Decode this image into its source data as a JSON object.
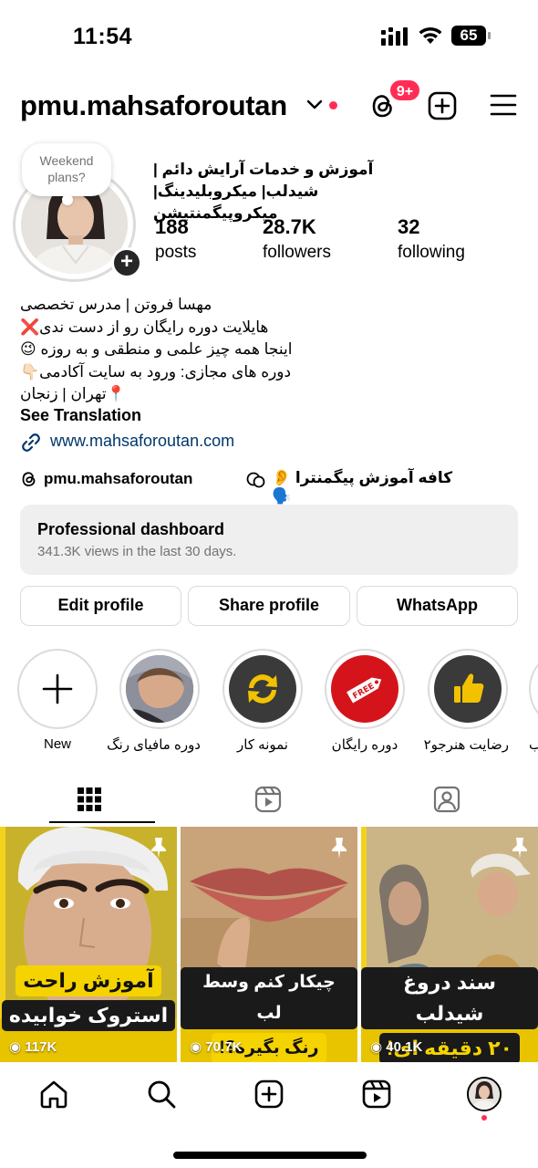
{
  "status": {
    "time": "11:54",
    "battery": "65"
  },
  "header": {
    "username": "pmu.mahsaforoutan",
    "notif_badge": "9+"
  },
  "note": {
    "line1": "Weekend",
    "line2": "plans?"
  },
  "profile": {
    "fullname": "آموزش و خدمات آرایش دائم | شیدلب| میکروبلیدینگ|میکروپیگمنتیشن",
    "stats": [
      {
        "num": "188",
        "label": "posts"
      },
      {
        "num": "28.7K",
        "label": "followers"
      },
      {
        "num": "32",
        "label": "following"
      }
    ],
    "bio": [
      "مهسا فروتن | مدرس تخصصی",
      "هایلایت دوره رایگان رو از دست ندی❌",
      "اینجا همه چیز علمی و منطقی و به روزه 😉",
      "دوره های مجازی: ورود به سایت آکادمی👇🏻",
      "📍تهران | زنجان"
    ],
    "see_translation": "See Translation",
    "link": "www.mahsaforoutan.com",
    "threads_handle": "pmu.mahsaforoutan",
    "channel": "کافه آموزش پیگمنترا 👂🗣️"
  },
  "dashboard": {
    "title": "Professional dashboard",
    "subtitle": "341.3K views in the last 30 days."
  },
  "buttons": {
    "edit": "Edit profile",
    "share": "Share profile",
    "whatsapp": "WhatsApp"
  },
  "highlights": [
    {
      "label": "New",
      "icon": "plus-icon"
    },
    {
      "label": "دوره مافیای رنگ",
      "icon": "photo"
    },
    {
      "label": "نمونه کار",
      "icon": "refresh-icon"
    },
    {
      "label": "دوره رایگان",
      "icon": "free-tag-icon"
    },
    {
      "label": "رضایت هنرجو۲",
      "icon": "thumbs-up-icon"
    },
    {
      "label": "ب",
      "icon": "partial"
    }
  ],
  "posts": [
    {
      "line1": "آموزش راحت",
      "line2": "استروک خوابیده",
      "views": "117K"
    },
    {
      "line1": "چیکار کنم وسط لب",
      "line2": "رنگ بگیره؟!",
      "views": "70.7K"
    },
    {
      "line1": "سند دروغ شیدلب",
      "line2": "۲۰ دقیقه ای!",
      "views": "40.1K"
    }
  ],
  "colors": {
    "accent_red": "#ff2d55",
    "link_blue": "#00376b",
    "caption_yellow": "#f5d300"
  }
}
